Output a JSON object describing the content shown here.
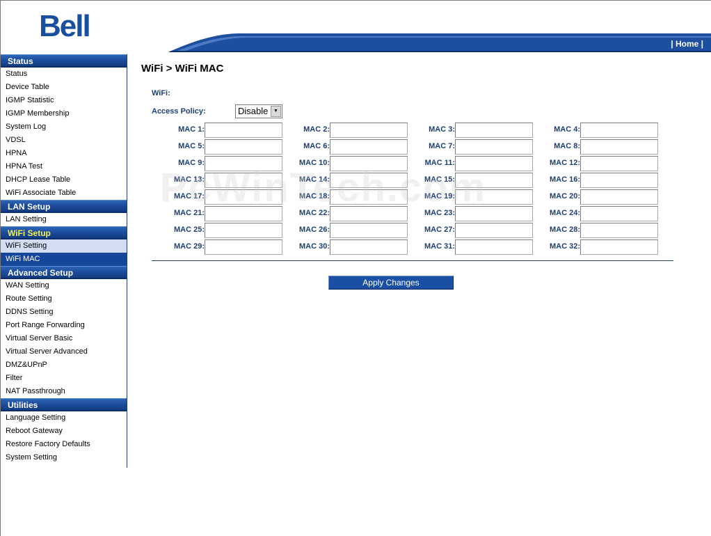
{
  "brand": {
    "logo_text": "Bell",
    "color": "#1a4fa0"
  },
  "header": {
    "home_label": "| Home |"
  },
  "sidebar": {
    "sections": [
      {
        "title": "Status",
        "items": [
          "Status",
          "Device Table",
          "IGMP Statistic",
          "IGMP Membership",
          "System Log",
          "VDSL",
          "HPNA",
          "HPNA Test",
          "DHCP Lease Table",
          "WiFi Associate Table"
        ]
      },
      {
        "title": "LAN Setup",
        "items": [
          "LAN Setting"
        ]
      },
      {
        "title": "WiFi Setup",
        "items": [
          "WiFi Setting",
          "WiFi MAC"
        ]
      },
      {
        "title": "Advanced Setup",
        "items": [
          "WAN Setting",
          "Route Setting",
          "DDNS Setting",
          "Port Range Forwarding",
          "Virtual Server Basic",
          "Virtual Server Advanced",
          "DMZ&UPnP",
          "Filter",
          "NAT Passthrough"
        ]
      },
      {
        "title": "Utilities",
        "items": [
          "Language Setting",
          "Reboot Gateway",
          "Restore Factory Defaults",
          "System Setting"
        ]
      }
    ],
    "active_section": "WiFi Setup",
    "highlighted_item": "WiFi Setting",
    "selected_item": "WiFi MAC"
  },
  "main": {
    "title": "WiFi > WiFi MAC",
    "wifi_label": "WiFi:",
    "access_policy_label": "Access Policy:",
    "access_policy_value": "Disable",
    "mac_labels": [
      "MAC 1:",
      "MAC 2:",
      "MAC 3:",
      "MAC 4:",
      "MAC 5:",
      "MAC 6:",
      "MAC 7:",
      "MAC 8:",
      "MAC 9:",
      "MAC 10:",
      "MAC 11:",
      "MAC 12:",
      "MAC 13:",
      "MAC 14:",
      "MAC 15:",
      "MAC 16:",
      "MAC 17:",
      "MAC 18:",
      "MAC 19:",
      "MAC 20:",
      "MAC 21:",
      "MAC 22:",
      "MAC 23:",
      "MAC 24:",
      "MAC 25:",
      "MAC 26:",
      "MAC 27:",
      "MAC 28:",
      "MAC 29:",
      "MAC 30:",
      "MAC 31:",
      "MAC 32:"
    ],
    "mac_values": [
      "",
      "",
      "",
      "",
      "",
      "",
      "",
      "",
      "",
      "",
      "",
      "",
      "",
      "",
      "",
      "",
      "",
      "",
      "",
      "",
      "",
      "",
      "",
      "",
      "",
      "",
      "",
      "",
      "",
      "",
      "",
      ""
    ],
    "apply_label": "Apply Changes"
  },
  "watermark": "PcWinTech.com"
}
